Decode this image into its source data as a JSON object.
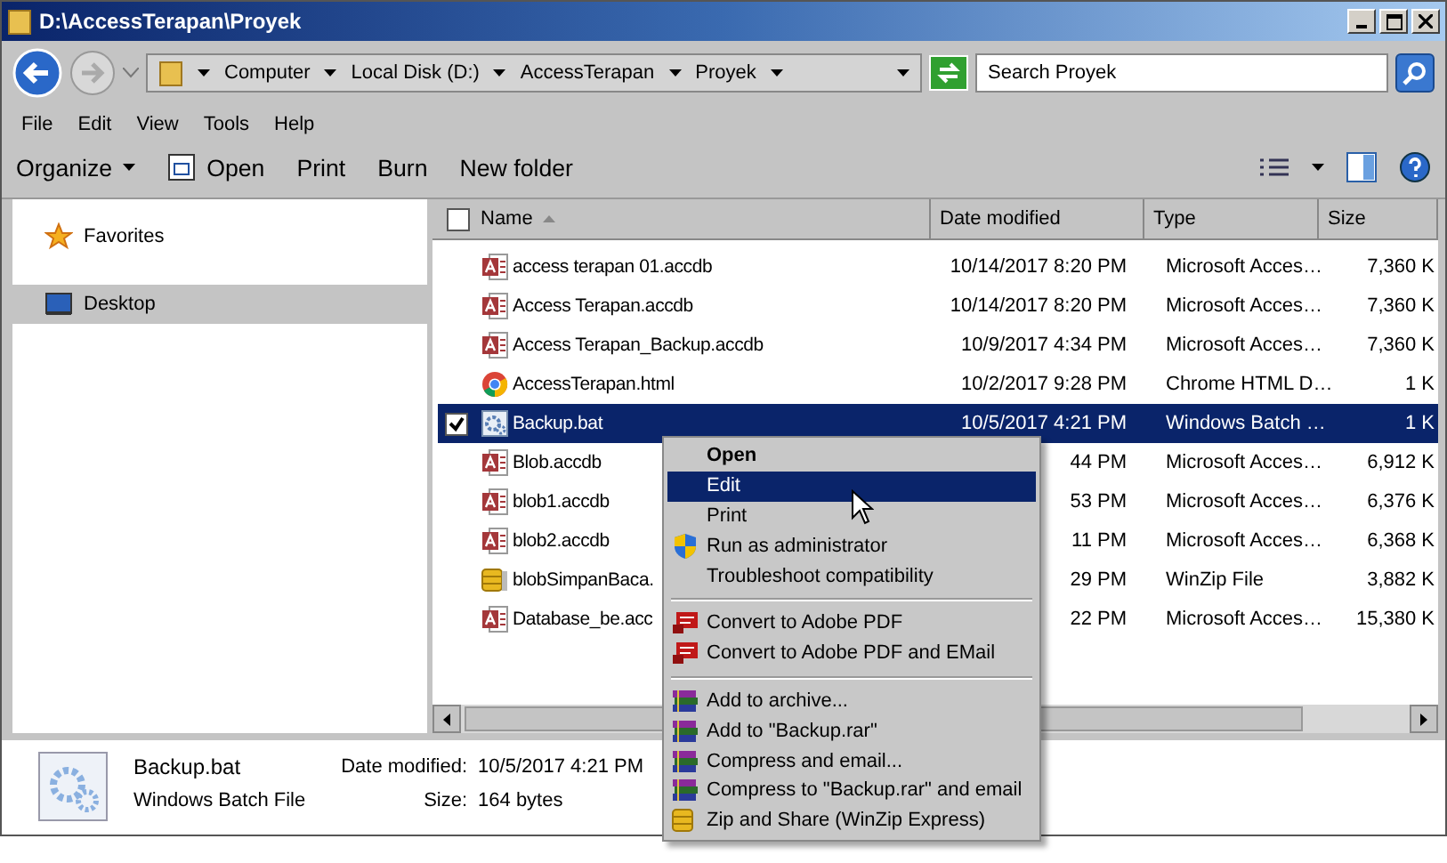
{
  "window": {
    "title": "D:\\AccessTerapan\\Proyek"
  },
  "address": {
    "crumbs": [
      "Computer",
      "Local Disk (D:)",
      "AccessTerapan",
      "Proyek"
    ]
  },
  "search": {
    "placeholder": "Search Proyek"
  },
  "menu_bar": [
    "File",
    "Edit",
    "View",
    "Tools",
    "Help"
  ],
  "toolbar": [
    {
      "label": "Organize",
      "kind": "dropdown"
    },
    {
      "label": "Open",
      "kind": "icon"
    },
    {
      "label": "Print",
      "kind": "plain"
    },
    {
      "label": "Burn",
      "kind": "plain"
    },
    {
      "label": "New folder",
      "kind": "plain"
    }
  ],
  "sidebar": {
    "items": [
      {
        "label": "Favorites",
        "kind": "star",
        "selected": false
      },
      {
        "label": "Desktop",
        "kind": "desktop",
        "selected": true
      }
    ]
  },
  "table": {
    "select_all": false,
    "columns": [
      "Name",
      "Date modified",
      "Type",
      "Size"
    ],
    "rows": [
      {
        "kind": "access",
        "name": "access terapan 01.accdb",
        "date": "10/14/2017 8:20 PM",
        "type": "Microsoft Acces…",
        "size": "7,360 K",
        "selected": false
      },
      {
        "kind": "access",
        "name": "Access Terapan.accdb",
        "date": "10/14/2017 8:20 PM",
        "type": "Microsoft Acces…",
        "size": "7,360 K",
        "selected": false
      },
      {
        "kind": "access",
        "name": "Access Terapan_Backup.accdb",
        "date": "10/9/2017 4:34 PM",
        "type": "Microsoft Acces…",
        "size": "7,360 K",
        "selected": false
      },
      {
        "kind": "chrome",
        "name": "AccessTerapan.html",
        "date": "10/2/2017 9:28 PM",
        "type": "Chrome HTML D…",
        "size": "1 K",
        "selected": false
      },
      {
        "kind": "batch",
        "name": "Backup.bat",
        "date": "10/5/2017 4:21 PM",
        "type": "Windows Batch …",
        "size": "1 K",
        "selected": true
      },
      {
        "kind": "access",
        "name": "Blob.accdb",
        "date": "44 PM",
        "type": "Microsoft Acces…",
        "size": "6,912 K",
        "selected": false
      },
      {
        "kind": "access",
        "name": "blob1.accdb",
        "date": "53 PM",
        "type": "Microsoft Acces…",
        "size": "6,376 K",
        "selected": false
      },
      {
        "kind": "access",
        "name": "blob2.accdb",
        "date": "11 PM",
        "type": "Microsoft Acces…",
        "size": "6,368 K",
        "selected": false
      },
      {
        "kind": "winzip",
        "name": "blobSimpanBaca.",
        "date": "29 PM",
        "type": "WinZip File",
        "size": "3,882 K",
        "selected": false
      },
      {
        "kind": "access",
        "name": "Database_be.acc",
        "date": "22 PM",
        "type": "Microsoft Acces…",
        "size": "15,380 K",
        "selected": false
      }
    ]
  },
  "details": {
    "name": "Backup.bat",
    "type": "Windows Batch File",
    "date_label": "Date modified:",
    "date": "10/5/2017 4:21 PM",
    "size_label": "Size:",
    "size": "164 bytes"
  },
  "context_menu": [
    {
      "kind": "plain",
      "label": "Open",
      "default": true,
      "selected": false
    },
    {
      "kind": "plain",
      "label": "Edit",
      "default": false,
      "selected": true
    },
    {
      "kind": "plain",
      "label": "Print",
      "default": false,
      "selected": false
    },
    {
      "kind": "shield",
      "label": "Run as administrator",
      "default": false,
      "selected": false
    },
    {
      "kind": "plain",
      "label": "Troubleshoot compatibility",
      "default": false,
      "selected": false
    },
    {
      "kind": "separator"
    },
    {
      "kind": "pdf",
      "label": "Convert to Adobe PDF",
      "default": false,
      "selected": false
    },
    {
      "kind": "pdf",
      "label": "Convert to Adobe PDF and EMail",
      "default": false,
      "selected": false
    },
    {
      "kind": "separator"
    },
    {
      "kind": "rar",
      "label": "Add to archive...",
      "default": false,
      "selected": false
    },
    {
      "kind": "rar",
      "label": "Add to \"Backup.rar\"",
      "default": false,
      "selected": false
    },
    {
      "kind": "rar",
      "label": "Compress and email...",
      "default": false,
      "selected": false
    },
    {
      "kind": "rar",
      "label": "Compress to \"Backup.rar\" and email",
      "default": false,
      "selected": false
    },
    {
      "kind": "winzip",
      "label": "Zip and Share (WinZip Express)",
      "default": false,
      "selected": false
    }
  ]
}
